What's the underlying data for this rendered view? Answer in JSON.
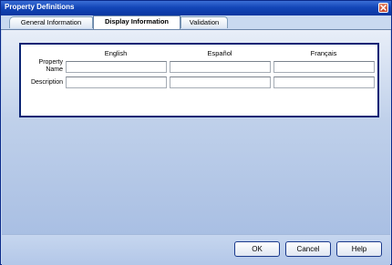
{
  "window": {
    "title": "Property Definitions"
  },
  "tabs": [
    {
      "label": "General Information"
    },
    {
      "label": "Display Information"
    },
    {
      "label": "Validation"
    }
  ],
  "form": {
    "columns": [
      "English",
      "Español",
      "Français"
    ],
    "rows": [
      {
        "label_line1": "Property",
        "label_line2": "Name"
      },
      {
        "label": "Description"
      }
    ],
    "values": {
      "property_name": [
        "",
        "",
        ""
      ],
      "description": [
        "",
        "",
        ""
      ]
    }
  },
  "buttons": {
    "ok": "OK",
    "cancel": "Cancel",
    "help": "Help"
  }
}
